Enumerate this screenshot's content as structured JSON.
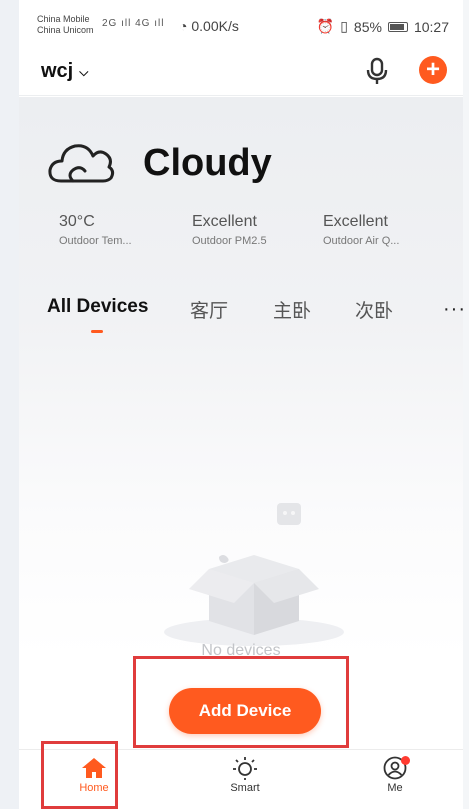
{
  "status_bar": {
    "carrier_1": "China Mobile",
    "carrier_2": "China Unicom",
    "signal": "2G ıll 4G ıll",
    "net_speed": "0.00K/s",
    "battery": "85%",
    "time": "10:27"
  },
  "header": {
    "account": "wcj",
    "mic_icon": "microphone-icon",
    "add_icon": "plus-icon"
  },
  "weather": {
    "icon": "cloud-icon",
    "condition": "Cloudy",
    "stats": [
      {
        "value": "30°C",
        "label": "Outdoor Tem..."
      },
      {
        "value": "Excellent",
        "label": "Outdoor PM2.5"
      },
      {
        "value": "Excellent",
        "label": "Outdoor Air Q..."
      }
    ]
  },
  "room_tabs": {
    "items": [
      "All Devices",
      "客厅",
      "主卧",
      "次卧"
    ],
    "active": "All Devices",
    "more": "···"
  },
  "empty_state": {
    "message": "No devices",
    "add_button": "Add Device"
  },
  "tab_bar": {
    "items": [
      {
        "label": "Home",
        "icon": "home-icon"
      },
      {
        "label": "Smart",
        "icon": "sun-icon"
      },
      {
        "label": "Me",
        "icon": "user-icon"
      }
    ],
    "active": "Home"
  },
  "colors": {
    "accent": "#ff5a1f",
    "highlight_box": "#e03c3c"
  }
}
